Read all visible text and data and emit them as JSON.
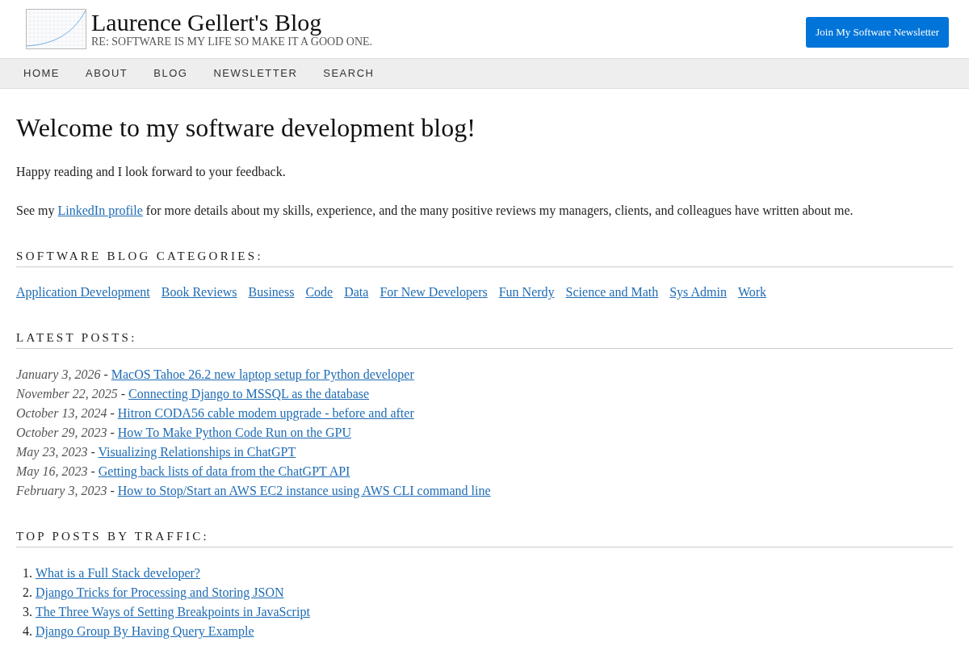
{
  "header": {
    "title": "Laurence Gellert's Blog",
    "tagline": "RE: SOFTWARE IS MY LIFE SO MAKE IT A GOOD ONE.",
    "newsletter_button": "Join My Software Newsletter"
  },
  "nav": [
    "HOME",
    "ABOUT",
    "BLOG",
    "NEWSLETTER",
    "SEARCH"
  ],
  "page": {
    "heading": "Welcome to my software development blog!",
    "intro": "Happy reading and I look forward to your feedback.",
    "linkedin_paragraph": {
      "before": "See my",
      "link": "LinkedIn profile",
      "after": "for more details about my skills, experience, and the many positive reviews my managers, clients, and colleagues have written about me."
    }
  },
  "categories": {
    "heading": "SOFTWARE BLOG CATEGORIES:",
    "links": [
      "Application Development",
      "Book Reviews",
      "Business",
      "Code",
      "Data",
      "For New Developers",
      "Fun Nerdy",
      "Science and Math",
      "Sys Admin",
      "Work"
    ]
  },
  "latest_posts": {
    "heading": "LATEST POSTS:",
    "posts": [
      {
        "date": "January 3, 2026",
        "separator": "-",
        "title": "MacOS Tahoe 26.2 new laptop setup for Python developer"
      },
      {
        "date": "November 22, 2025",
        "separator": "-",
        "title": "Connecting Django to MSSQL as the database"
      },
      {
        "date": "October 13, 2024",
        "separator": "-",
        "title": "Hitron CODA56 cable modem upgrade - before and after"
      },
      {
        "date": "October 29, 2023",
        "separator": "-",
        "title": "How To Make Python Code Run on the GPU"
      },
      {
        "date": "May 23, 2023",
        "separator": "-",
        "title": "Visualizing Relationships in ChatGPT"
      },
      {
        "date": "May 16, 2023",
        "separator": "-",
        "title": "Getting back lists of data from the ChatGPT API"
      },
      {
        "date": "February 3, 2023",
        "separator": "-",
        "title": "How to Stop/Start an AWS EC2 instance using AWS CLI command line"
      }
    ]
  },
  "top_posts": {
    "heading": "TOP POSTS BY TRAFFIC:",
    "posts": [
      {
        "number": "1.",
        "title": "What is a Full Stack developer?"
      },
      {
        "number": "2.",
        "title": "Django Tricks for Processing and Storing JSON"
      },
      {
        "number": "3.",
        "title": "The Three Ways of Setting Breakpoints in JavaScript"
      },
      {
        "number": "4.",
        "title": "Django Group By Having Query Example"
      }
    ]
  }
}
